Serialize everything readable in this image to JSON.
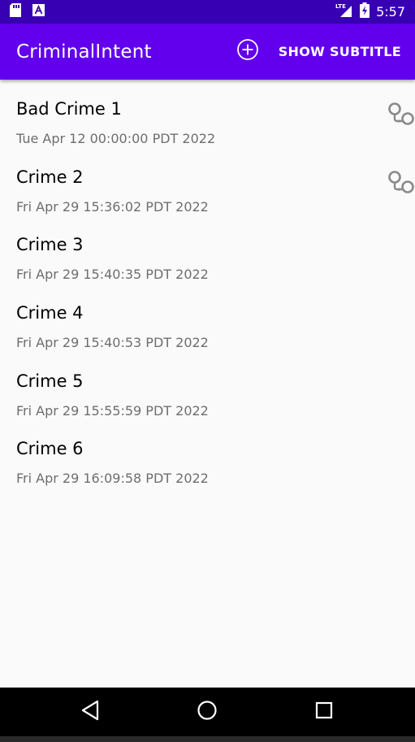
{
  "status_bar": {
    "time": "5:57",
    "network": "LTE",
    "icons": [
      "sd-card-icon",
      "a-notification-icon",
      "signal-icon",
      "battery-charging-icon"
    ]
  },
  "app_bar": {
    "title": "CriminalIntent",
    "add_icon": "add-circle-icon",
    "subtitle_label": "SHOW SUBTITLE"
  },
  "crimes": [
    {
      "title": "Bad Crime 1",
      "date": "Tue Apr 12 00:00:00 PDT 2022",
      "solved": true
    },
    {
      "title": "Crime 2",
      "date": "Fri Apr 29 15:36:02 PDT 2022",
      "solved": true
    },
    {
      "title": "Crime 3",
      "date": "Fri Apr 29 15:40:35 PDT 2022",
      "solved": false
    },
    {
      "title": "Crime 4",
      "date": "Fri Apr 29 15:40:53 PDT 2022",
      "solved": false
    },
    {
      "title": "Crime 5",
      "date": "Fri Apr 29 15:55:59 PDT 2022",
      "solved": false
    },
    {
      "title": "Crime 6",
      "date": "Fri Apr 29 16:09:58 PDT 2022",
      "solved": false
    }
  ],
  "nav_bar": {
    "icons": [
      "back-icon",
      "home-icon",
      "recents-icon"
    ]
  },
  "colors": {
    "status_bar": "#3700b3",
    "app_bar": "#6200ee",
    "background": "#fafafa",
    "date_text": "#6e6e6e"
  }
}
